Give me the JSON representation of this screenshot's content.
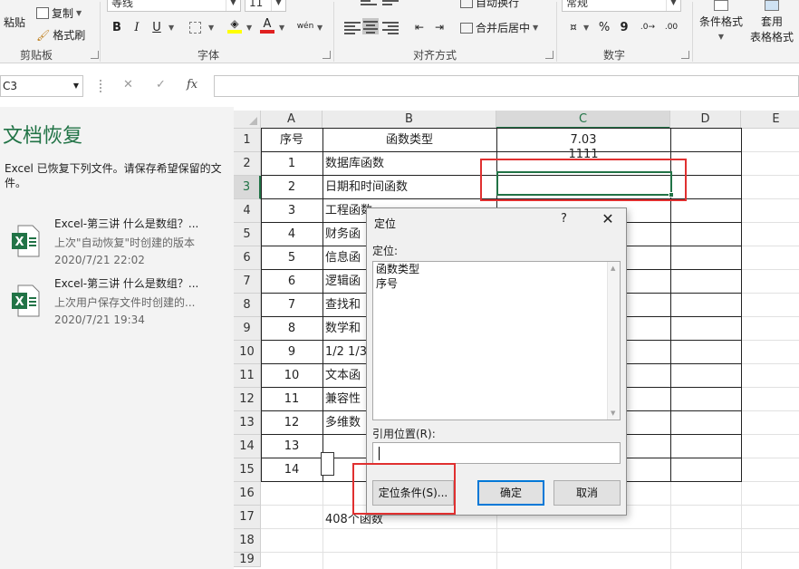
{
  "ribbon": {
    "clipboard": {
      "paste": "粘贴",
      "copy": "复制",
      "format_painter": "格式刷",
      "label": "剪贴板"
    },
    "font": {
      "name": "等线",
      "size": "11",
      "bold": "B",
      "italic": "I",
      "underline": "U",
      "phonetic": "wén",
      "label": "字体"
    },
    "alignment": {
      "wrap": "自动换行",
      "merge": "合并后居中",
      "label": "对齐方式"
    },
    "number": {
      "format": "常规",
      "percent": "%",
      "comma": "9",
      "label": "数字"
    },
    "styles": {
      "conditional": "条件格式",
      "table_format_1": "套用",
      "table_format_2": "表格格式"
    }
  },
  "formula_bar": {
    "name_box": "C3",
    "cancel": "✕",
    "enter": "✓",
    "fx": "fx"
  },
  "recovery": {
    "title": "文档恢复",
    "description": "Excel 已恢复下列文件。请保存希望保留的文件。",
    "files": [
      {
        "name": "Excel-第三讲 什么是数组？...",
        "note": "上次\"自动恢复\"时创建的版本",
        "time": "2020/7/21 22:02"
      },
      {
        "name": "Excel-第三讲 什么是数组？...",
        "note": "上次用户保存文件时创建的...",
        "time": "2020/7/21 19:34"
      }
    ]
  },
  "grid": {
    "columns": [
      "A",
      "B",
      "C",
      "D",
      "E"
    ],
    "rows": [
      "1",
      "2",
      "3",
      "4",
      "5",
      "6",
      "7",
      "8",
      "9",
      "10",
      "11",
      "12",
      "13",
      "14",
      "15",
      "16",
      "17",
      "18",
      "19"
    ],
    "header": {
      "a": "序号",
      "b": "函数类型",
      "c": "7.03"
    },
    "data": [
      {
        "a": "1",
        "b": "数据库函数",
        "c": "1111"
      },
      {
        "a": "2",
        "b": "日期和时间函数",
        "c": ""
      },
      {
        "a": "3",
        "b": "工程函数"
      },
      {
        "a": "4",
        "b": "财务函"
      },
      {
        "a": "5",
        "b": "信息函"
      },
      {
        "a": "6",
        "b": "逻辑函"
      },
      {
        "a": "7",
        "b": "查找和"
      },
      {
        "a": "8",
        "b": "数学和"
      },
      {
        "a": "9",
        "b": "1/2 1/3"
      },
      {
        "a": "10",
        "b": "文本函"
      },
      {
        "a": "11",
        "b": "兼容性"
      },
      {
        "a": "12",
        "b": "多维数"
      },
      {
        "a": "13",
        "b": ""
      },
      {
        "a": "14",
        "b": ""
      }
    ],
    "footer_note": "408个函数"
  },
  "dialog": {
    "title": "定位",
    "help": "?",
    "close": "✕",
    "goto_label": "定位:",
    "items": [
      "函数类型",
      "序号"
    ],
    "reference_label": "引用位置(R):",
    "reference_value": "",
    "special_button": "定位条件(S)...",
    "ok_button": "确定",
    "cancel_button": "取消"
  },
  "colors": {
    "accent": "#217346",
    "highlight": "#e03030",
    "focus": "#0078d7"
  }
}
